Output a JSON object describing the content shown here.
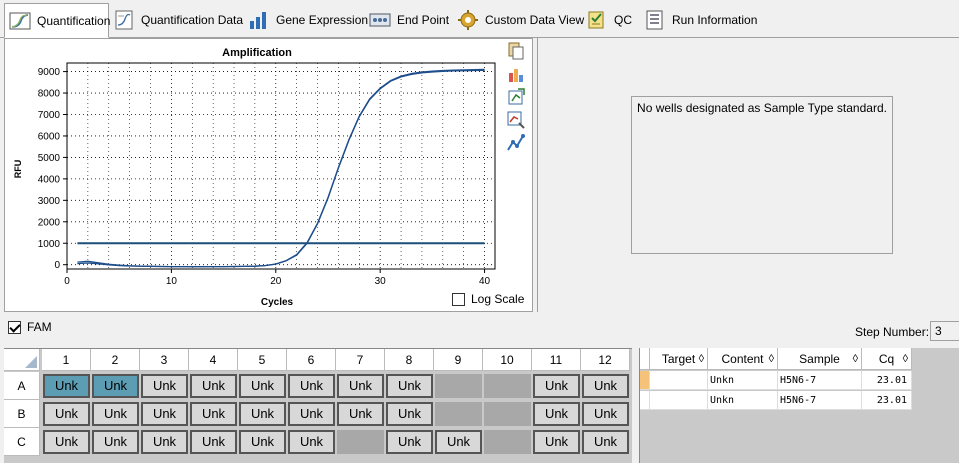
{
  "tabs": [
    {
      "label": "Quantification",
      "icon": "amplification-icon"
    },
    {
      "label": "Quantification Data",
      "icon": "quant-data-icon"
    },
    {
      "label": "Gene Expression",
      "icon": "bar-chart-icon"
    },
    {
      "label": "End Point",
      "icon": "endpoint-icon"
    },
    {
      "label": "Custom Data View",
      "icon": "gear-icon"
    },
    {
      "label": "QC",
      "icon": "checklist-icon"
    },
    {
      "label": "Run Information",
      "icon": "document-icon"
    }
  ],
  "amplification": {
    "title": "Amplification",
    "xlabel": "Cycles",
    "ylabel": "RFU",
    "log_scale_label": "Log Scale",
    "log_scale_checked": false
  },
  "chart_data": {
    "type": "line",
    "title": "Amplification",
    "xlabel": "Cycles",
    "ylabel": "RFU",
    "xlim": [
      0,
      41
    ],
    "ylim": [
      -200,
      9400
    ],
    "xticks": [
      0,
      10,
      20,
      30,
      40
    ],
    "yticks": [
      0,
      1000,
      2000,
      3000,
      4000,
      5000,
      6000,
      7000,
      8000,
      9000
    ],
    "grid": true,
    "threshold": 1000,
    "series": [
      {
        "color": "#1f4e8c",
        "x": [
          1,
          2,
          3,
          4,
          5,
          6,
          7,
          8,
          9,
          10,
          11,
          12,
          13,
          14,
          15,
          16,
          17,
          18,
          19,
          20,
          21,
          22,
          23,
          24,
          25,
          26,
          27,
          28,
          29,
          30,
          31,
          32,
          33,
          34,
          35,
          36,
          37,
          38,
          39,
          40
        ],
        "y": [
          50,
          80,
          40,
          -10,
          -40,
          -60,
          -70,
          -80,
          -85,
          -90,
          -90,
          -92,
          -92,
          -90,
          -88,
          -85,
          -80,
          -70,
          -40,
          30,
          180,
          450,
          1000,
          1900,
          3100,
          4500,
          5800,
          6900,
          7700,
          8200,
          8550,
          8750,
          8870,
          8940,
          8980,
          9010,
          9030,
          9040,
          9050,
          9060
        ]
      },
      {
        "color": "#1f4e8c",
        "x": [
          1,
          2,
          3,
          4,
          5,
          6,
          7,
          8,
          9,
          10,
          11,
          12,
          13,
          14,
          15,
          16,
          17,
          18,
          19,
          20,
          21,
          22,
          23,
          24,
          25,
          26,
          27,
          28,
          29,
          30,
          31,
          32,
          33,
          34,
          35,
          36,
          37,
          38,
          39,
          40
        ],
        "y": [
          120,
          160,
          90,
          20,
          -20,
          -50,
          -65,
          -75,
          -82,
          -88,
          -90,
          -90,
          -90,
          -88,
          -86,
          -83,
          -78,
          -68,
          -38,
          35,
          190,
          470,
          1030,
          1930,
          3130,
          4530,
          5830,
          6930,
          7730,
          8230,
          8580,
          8790,
          8910,
          8980,
          9020,
          9050,
          9070,
          9080,
          9090,
          9100
        ]
      }
    ]
  },
  "standard_curve": {
    "message": "No wells designated as Sample Type standard."
  },
  "fluor": {
    "label": "FAM",
    "checked": true
  },
  "step": {
    "label": "Step Number:",
    "value": "3"
  },
  "plate": {
    "columns": [
      "1",
      "2",
      "3",
      "4",
      "5",
      "6",
      "7",
      "8",
      "9",
      "10",
      "11",
      "12"
    ],
    "rows": [
      {
        "label": "A",
        "wells": [
          "Unk",
          "Unk",
          "Unk",
          "Unk",
          "Unk",
          "Unk",
          "Unk",
          "Unk",
          "",
          "",
          "Unk",
          "Unk"
        ],
        "selected": [
          0,
          1
        ]
      },
      {
        "label": "B",
        "wells": [
          "Unk",
          "Unk",
          "Unk",
          "Unk",
          "Unk",
          "Unk",
          "Unk",
          "Unk",
          "",
          "",
          "Unk",
          "Unk"
        ],
        "selected": []
      },
      {
        "label": "C",
        "wells": [
          "Unk",
          "Unk",
          "Unk",
          "Unk",
          "Unk",
          "Unk",
          "",
          "Unk",
          "Unk",
          "",
          "Unk",
          "Unk"
        ],
        "selected": []
      }
    ]
  },
  "well_table": {
    "columns": [
      "Target",
      "Content",
      "Sample",
      "Cq"
    ],
    "sort_icon": "◊",
    "rows": [
      {
        "target": "",
        "content": "Unkn",
        "sample": "H5N6-7",
        "cq": "23.01"
      },
      {
        "target": "",
        "content": "Unkn",
        "sample": "H5N6-7",
        "cq": "23.01"
      }
    ]
  }
}
